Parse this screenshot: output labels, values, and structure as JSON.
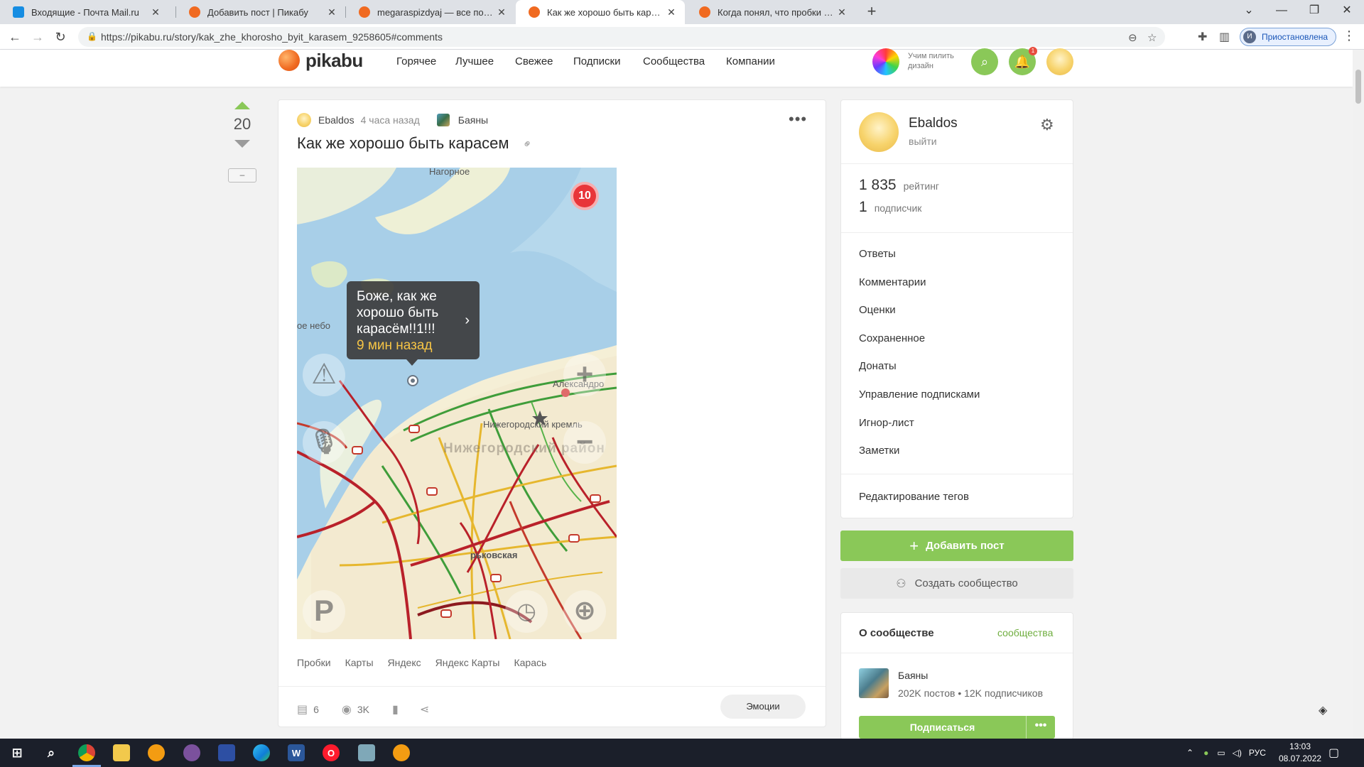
{
  "browser": {
    "tabs": [
      {
        "title": "Входящие - Почта Mail.ru",
        "favicon_color": "#168de2",
        "active": false
      },
      {
        "title": "Добавить пост | Пикабу",
        "favicon_color": "#f06a21",
        "active": false
      },
      {
        "title": "megaraspizdyaj — все посты пол",
        "favicon_color": "#f06a21",
        "active": false
      },
      {
        "title": "Как же хорошо быть карасем | П",
        "favicon_color": "#f06a21",
        "active": true
      },
      {
        "title": "Когда понял, что пробки тебя н",
        "favicon_color": "#f06a21",
        "active": false
      }
    ],
    "url": "https://pikabu.ru/story/kak_zhe_khorosho_byit_karasem_9258605#comments",
    "profile_status": "Приостановлена",
    "profile_initial": "И"
  },
  "site": {
    "logo": "pikabu",
    "nav": [
      "Горячее",
      "Лучшее",
      "Свежее",
      "Подписки",
      "Сообщества",
      "Компании"
    ],
    "promo_text": "Учим пилить дизайн",
    "notif_count": "1"
  },
  "story": {
    "rating": "20",
    "author": "Ebaldos",
    "time": "4 часа назад",
    "community": "Баяны",
    "title": "Как же хорошо быть карасем",
    "map": {
      "tooltip_text": "Боже, как же хорошо быть карасём!!1!!!",
      "tooltip_time": "9 мин назад",
      "jam_level": "10",
      "labels": {
        "top": "Нагорное",
        "sky": "ое небо",
        "alex": "Александро",
        "kremlin": "Нижегородский кремль",
        "district": "Нижегородский район",
        "station": "рьковская"
      }
    },
    "tags": [
      "Пробки",
      "Карты",
      "Яндекс",
      "Яндекс Карты",
      "Карась"
    ],
    "comments": "6",
    "views": "3K",
    "emotions_label": "Эмоции"
  },
  "sidebar": {
    "user": {
      "name": "Ebaldos",
      "logout": "выйти"
    },
    "stats": [
      {
        "num": "1 835",
        "label": "рейтинг"
      },
      {
        "num": "1",
        "label": "подписчик"
      }
    ],
    "menu": [
      "Ответы",
      "Комментарии",
      "Оценки",
      "Сохраненное",
      "Донаты",
      "Управление подписками",
      "Игнор-лист",
      "Заметки"
    ],
    "tags_edit": "Редактирование тегов",
    "add_post": "Добавить пост",
    "create_community": "Создать сообщество",
    "about": {
      "title": "О сообществе",
      "link": "сообщества",
      "name": "Баяны",
      "stats": "202K постов • 12K подписчиков",
      "subscribe": "Подписаться"
    }
  },
  "taskbar": {
    "lang": "РУС",
    "time": "13:03",
    "date": "08.07.2022"
  },
  "colors": {
    "accent_green": "#8ac858",
    "jam_red": "#e8353a"
  }
}
